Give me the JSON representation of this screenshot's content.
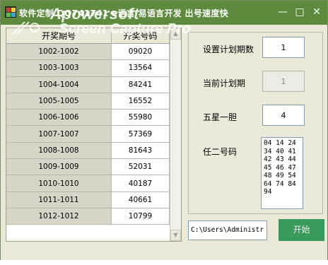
{
  "window": {
    "title": "软件定制 QQ741741 e语言 易语言开发 出号速度快",
    "controls": [
      "—",
      "□",
      "✕"
    ]
  },
  "watermark": {
    "line1": "Apowersoft",
    "line2": "Screen Capture Pro"
  },
  "table": {
    "columns": [
      "开奖期号",
      "开奖号码"
    ],
    "rows": [
      {
        "period": "1002-1002",
        "number": "09020"
      },
      {
        "period": "1003-1003",
        "number": "13564"
      },
      {
        "period": "1004-1004",
        "number": "84241"
      },
      {
        "period": "1005-1005",
        "number": "16552"
      },
      {
        "period": "1006-1006",
        "number": "55980"
      },
      {
        "period": "1007-1007",
        "number": "57369"
      },
      {
        "period": "1008-1008",
        "number": "81643"
      },
      {
        "period": "1009-1009",
        "number": "52031"
      },
      {
        "period": "1010-1010",
        "number": "40187"
      },
      {
        "period": "1011-1011",
        "number": "40661"
      },
      {
        "period": "1012-1012",
        "number": "10799"
      }
    ]
  },
  "form": {
    "plan_periods_label": "设置计划期数",
    "plan_periods_value": "1",
    "current_plan_label": "当前计划期",
    "current_plan_value": "1",
    "five_star_label": "五星一胆",
    "five_star_value": "4",
    "any_two_label": "任二号码",
    "any_two_value": "04 14 24\n34 40 41\n42 43 44\n45 46 47\n48 49 54\n64 74 84\n94"
  },
  "bottom": {
    "path_value": "C:\\Users\\Administr",
    "start_label": "开始"
  },
  "colors": {
    "titlebar": "#5d8a3c",
    "start_button": "#3a9a5c",
    "window_bg": "#ece9d8"
  }
}
